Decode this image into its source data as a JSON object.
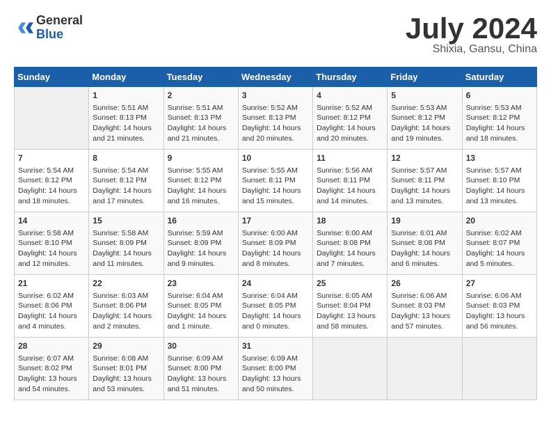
{
  "header": {
    "logo_general": "General",
    "logo_blue": "Blue",
    "month_title": "July 2024",
    "subtitle": "Shixia, Gansu, China"
  },
  "weekdays": [
    "Sunday",
    "Monday",
    "Tuesday",
    "Wednesday",
    "Thursday",
    "Friday",
    "Saturday"
  ],
  "weeks": [
    [
      {
        "day": "",
        "info": ""
      },
      {
        "day": "1",
        "info": "Sunrise: 5:51 AM\nSunset: 8:13 PM\nDaylight: 14 hours\nand 21 minutes."
      },
      {
        "day": "2",
        "info": "Sunrise: 5:51 AM\nSunset: 8:13 PM\nDaylight: 14 hours\nand 21 minutes."
      },
      {
        "day": "3",
        "info": "Sunrise: 5:52 AM\nSunset: 8:13 PM\nDaylight: 14 hours\nand 20 minutes."
      },
      {
        "day": "4",
        "info": "Sunrise: 5:52 AM\nSunset: 8:12 PM\nDaylight: 14 hours\nand 20 minutes."
      },
      {
        "day": "5",
        "info": "Sunrise: 5:53 AM\nSunset: 8:12 PM\nDaylight: 14 hours\nand 19 minutes."
      },
      {
        "day": "6",
        "info": "Sunrise: 5:53 AM\nSunset: 8:12 PM\nDaylight: 14 hours\nand 18 minutes."
      }
    ],
    [
      {
        "day": "7",
        "info": "Sunrise: 5:54 AM\nSunset: 8:12 PM\nDaylight: 14 hours\nand 18 minutes."
      },
      {
        "day": "8",
        "info": "Sunrise: 5:54 AM\nSunset: 8:12 PM\nDaylight: 14 hours\nand 17 minutes."
      },
      {
        "day": "9",
        "info": "Sunrise: 5:55 AM\nSunset: 8:12 PM\nDaylight: 14 hours\nand 16 minutes."
      },
      {
        "day": "10",
        "info": "Sunrise: 5:55 AM\nSunset: 8:11 PM\nDaylight: 14 hours\nand 15 minutes."
      },
      {
        "day": "11",
        "info": "Sunrise: 5:56 AM\nSunset: 8:11 PM\nDaylight: 14 hours\nand 14 minutes."
      },
      {
        "day": "12",
        "info": "Sunrise: 5:57 AM\nSunset: 8:11 PM\nDaylight: 14 hours\nand 13 minutes."
      },
      {
        "day": "13",
        "info": "Sunrise: 5:57 AM\nSunset: 8:10 PM\nDaylight: 14 hours\nand 13 minutes."
      }
    ],
    [
      {
        "day": "14",
        "info": "Sunrise: 5:58 AM\nSunset: 8:10 PM\nDaylight: 14 hours\nand 12 minutes."
      },
      {
        "day": "15",
        "info": "Sunrise: 5:58 AM\nSunset: 8:09 PM\nDaylight: 14 hours\nand 11 minutes."
      },
      {
        "day": "16",
        "info": "Sunrise: 5:59 AM\nSunset: 8:09 PM\nDaylight: 14 hours\nand 9 minutes."
      },
      {
        "day": "17",
        "info": "Sunrise: 6:00 AM\nSunset: 8:09 PM\nDaylight: 14 hours\nand 8 minutes."
      },
      {
        "day": "18",
        "info": "Sunrise: 6:00 AM\nSunset: 8:08 PM\nDaylight: 14 hours\nand 7 minutes."
      },
      {
        "day": "19",
        "info": "Sunrise: 6:01 AM\nSunset: 8:08 PM\nDaylight: 14 hours\nand 6 minutes."
      },
      {
        "day": "20",
        "info": "Sunrise: 6:02 AM\nSunset: 8:07 PM\nDaylight: 14 hours\nand 5 minutes."
      }
    ],
    [
      {
        "day": "21",
        "info": "Sunrise: 6:02 AM\nSunset: 8:06 PM\nDaylight: 14 hours\nand 4 minutes."
      },
      {
        "day": "22",
        "info": "Sunrise: 6:03 AM\nSunset: 8:06 PM\nDaylight: 14 hours\nand 2 minutes."
      },
      {
        "day": "23",
        "info": "Sunrise: 6:04 AM\nSunset: 8:05 PM\nDaylight: 14 hours\nand 1 minute."
      },
      {
        "day": "24",
        "info": "Sunrise: 6:04 AM\nSunset: 8:05 PM\nDaylight: 14 hours\nand 0 minutes."
      },
      {
        "day": "25",
        "info": "Sunrise: 6:05 AM\nSunset: 8:04 PM\nDaylight: 13 hours\nand 58 minutes."
      },
      {
        "day": "26",
        "info": "Sunrise: 6:06 AM\nSunset: 8:03 PM\nDaylight: 13 hours\nand 57 minutes."
      },
      {
        "day": "27",
        "info": "Sunrise: 6:06 AM\nSunset: 8:03 PM\nDaylight: 13 hours\nand 56 minutes."
      }
    ],
    [
      {
        "day": "28",
        "info": "Sunrise: 6:07 AM\nSunset: 8:02 PM\nDaylight: 13 hours\nand 54 minutes."
      },
      {
        "day": "29",
        "info": "Sunrise: 6:08 AM\nSunset: 8:01 PM\nDaylight: 13 hours\nand 53 minutes."
      },
      {
        "day": "30",
        "info": "Sunrise: 6:09 AM\nSunset: 8:00 PM\nDaylight: 13 hours\nand 51 minutes."
      },
      {
        "day": "31",
        "info": "Sunrise: 6:09 AM\nSunset: 8:00 PM\nDaylight: 13 hours\nand 50 minutes."
      },
      {
        "day": "",
        "info": ""
      },
      {
        "day": "",
        "info": ""
      },
      {
        "day": "",
        "info": ""
      }
    ]
  ]
}
